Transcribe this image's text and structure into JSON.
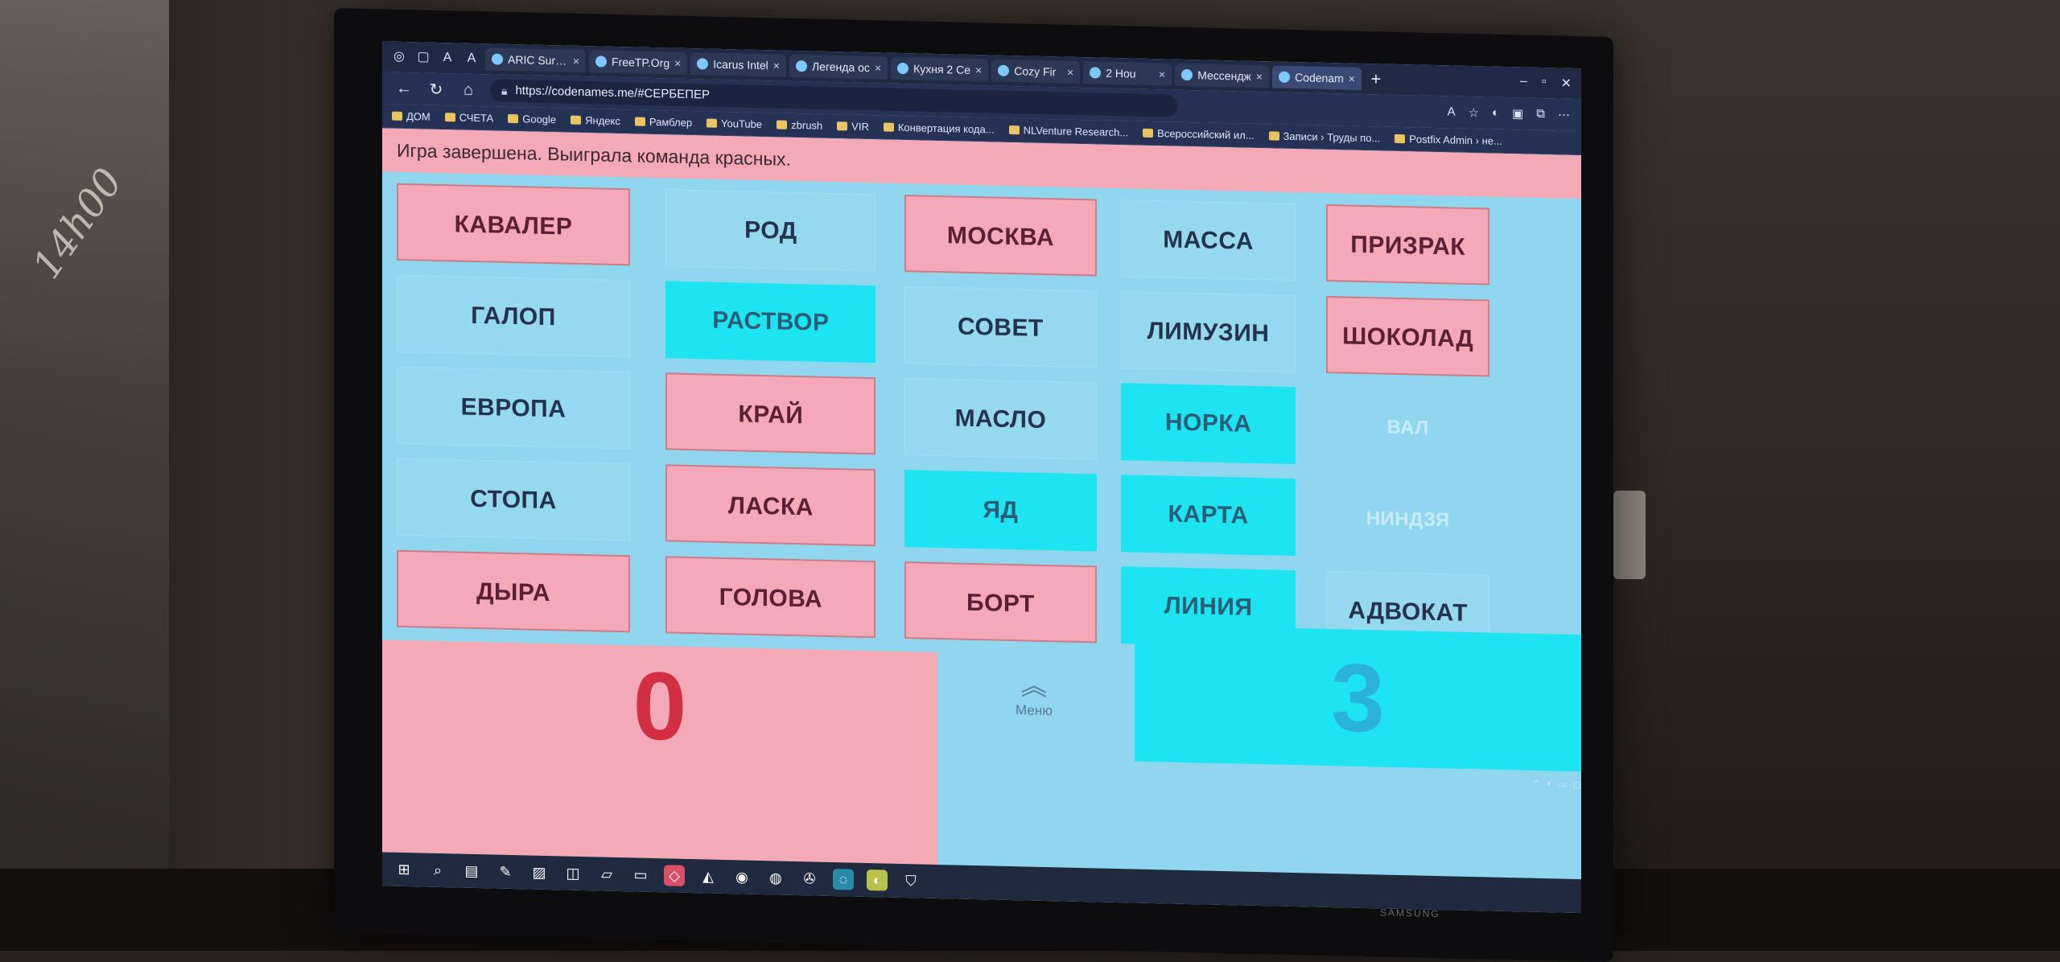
{
  "browser": {
    "tabs": [
      {
        "label": "ARIC Surviv"
      },
      {
        "label": "FreeTP.Org"
      },
      {
        "label": "Icarus Intel"
      },
      {
        "label": "Легенда ос"
      },
      {
        "label": "Кухня 2 Се"
      },
      {
        "label": "Cozy Fir"
      },
      {
        "label": "2 Hou"
      },
      {
        "label": "Мессендж"
      },
      {
        "label": "Codenam"
      }
    ],
    "url": "https://codenames.me/#СЕРБЕПЕР",
    "bookmarks": [
      "ДОМ",
      "СЧЕТА",
      "Google",
      "Яндекс",
      "Рамблер",
      "YouTube",
      "zbrush",
      "VIR",
      "Конвертация кода...",
      "NLVenture Research...",
      "Всероссийский ил...",
      "Записи › Труды по...",
      "Postfix Admin › не..."
    ]
  },
  "game": {
    "banner": "Игра завершена. Выиграла команда красных.",
    "cards": [
      {
        "word": "КАВАЛЕР",
        "team": "red"
      },
      {
        "word": "РОД",
        "team": "neutral"
      },
      {
        "word": "МОСКВА",
        "team": "red"
      },
      {
        "word": "МАССА",
        "team": "neutral"
      },
      {
        "word": "ПРИЗРАК",
        "team": "red"
      },
      {
        "word": "ГАЛОП",
        "team": "neutral"
      },
      {
        "word": "РАСТВОР",
        "team": "blue"
      },
      {
        "word": "СОВЕТ",
        "team": "neutral"
      },
      {
        "word": "ЛИМУЗИН",
        "team": "neutral"
      },
      {
        "word": "ШОКОЛАД",
        "team": "red"
      },
      {
        "word": "ЕВРОПА",
        "team": "neutral"
      },
      {
        "word": "КРАЙ",
        "team": "red"
      },
      {
        "word": "МАСЛО",
        "team": "neutral"
      },
      {
        "word": "НОРКА",
        "team": "blue"
      },
      {
        "word": "ВАЛ",
        "team": "hidden"
      },
      {
        "word": "СТОПА",
        "team": "neutral"
      },
      {
        "word": "ЛАСКА",
        "team": "red"
      },
      {
        "word": "ЯД",
        "team": "blue"
      },
      {
        "word": "КАРТА",
        "team": "blue"
      },
      {
        "word": "НИНДЗЯ",
        "team": "hidden"
      },
      {
        "word": "ДЫРА",
        "team": "red"
      },
      {
        "word": "ГОЛОВА",
        "team": "red"
      },
      {
        "word": "БОРТ",
        "team": "red"
      },
      {
        "word": "ЛИНИЯ",
        "team": "blue"
      },
      {
        "word": "АДВОКАТ",
        "team": "neutral"
      }
    ],
    "red_score": "0",
    "blue_score": "3",
    "menu_label": "Меню"
  },
  "decor": {
    "poster_text": "14h00",
    "tv_brand": "SAMSUNG"
  },
  "colors": {
    "red_card": "#f4a8b8",
    "blue_card": "#1ee3f1",
    "neutral_card": "#96d9ef",
    "red_score_text": "#d32f43"
  }
}
